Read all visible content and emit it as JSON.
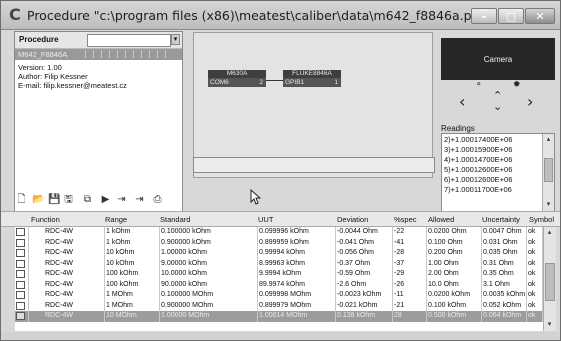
{
  "window": {
    "title": "Procedure \"c:\\program files (x86)\\meatest\\caliber\\data\\m642_f8846a.pro\"",
    "app_icon_glyph": "C",
    "minimize_glyph": "–",
    "maximize_glyph": "□",
    "close_glyph": "✕"
  },
  "procedure": {
    "label": "Procedure",
    "search_value": "",
    "combo_glyph": "▾",
    "item_name": "M642_F8846A",
    "info_lines": [
      "Version: 1.00",
      "Author: Filip Kessner",
      "E-mail: filip.kessner@meatest.cz"
    ]
  },
  "toolbar": {
    "new_glyph": "🗋",
    "open_glyph": "📂",
    "save_glyph": "💾",
    "save_as_glyph": "🖫",
    "link_glyph": "⧉",
    "run_glyph": "▶",
    "step_glyph": "⇥",
    "step2_glyph": "⇥",
    "report_glyph": "⎙"
  },
  "diagram": {
    "node1": {
      "title": "M630A",
      "port": "COM6",
      "number": "2"
    },
    "node2": {
      "title": "FLUKE8846A",
      "port": "GPIB1",
      "number": "1"
    }
  },
  "camera": {
    "label": "Camera",
    "ctrl_rec": "⚬",
    "ctrl_light": "✹",
    "left": "‹",
    "right": "›",
    "up": "⌃",
    "down": "⌄"
  },
  "readings": {
    "label": "Readings",
    "items": [
      "2)+1.00017400E+06",
      "3)+1.00015900E+06",
      "4)+1.00014700E+06",
      "5)+1.00012600E+06",
      "6)+1.00012600E+06",
      "7)+1.00011700E+06"
    ],
    "up_arrow": "▴",
    "down_arrow": "▾"
  },
  "grid": {
    "columns": [
      "Function",
      "Range",
      "Standard",
      "UUT",
      "Deviation",
      "%spec",
      "Allowed",
      "Uncertainty",
      "Symbol"
    ],
    "rows": [
      [
        "RDC-4W",
        "1 kOhm",
        "0.100000 kOhm",
        "0.099996 kOhm",
        "-0.0044 Ohm",
        "-22",
        "0.0200 Ohm",
        "0.0047 Ohm",
        "ok"
      ],
      [
        "RDC-4W",
        "1 kOhm",
        "0.900000 kOhm",
        "0.899959 kOhm",
        "-0.041 Ohm",
        "-41",
        "0.100 Ohm",
        "0.031 Ohm",
        "ok"
      ],
      [
        "RDC-4W",
        "10 kOhm",
        "1.00000 kOhm",
        "0.99994 kOhm",
        "-0.056 Ohm",
        "-28",
        "0.200 Ohm",
        "0.035 Ohm",
        "ok"
      ],
      [
        "RDC-4W",
        "10 kOhm",
        "9.00000 kOhm",
        "8.99963 kOhm",
        "-0.37 Ohm",
        "-37",
        "1.00 Ohm",
        "0.31 Ohm",
        "ok"
      ],
      [
        "RDC-4W",
        "100 kOhm",
        "10.0000 kOhm",
        "9.9994 kOhm",
        "-0.59 Ohm",
        "-29",
        "2.00 Ohm",
        "0.35 Ohm",
        "ok"
      ],
      [
        "RDC-4W",
        "100 kOhm",
        "90.0000 kOhm",
        "89.9974 kOhm",
        "-2.6 Ohm",
        "-26",
        "10.0 Ohm",
        "3.1 Ohm",
        "ok"
      ],
      [
        "RDC-4W",
        "1 MOhm",
        "0.100000 MOhm",
        "0.099998 MOhm",
        "-0.0023 kOhm",
        "-11",
        "0.0200 kOhm",
        "0.0035 kOhm",
        "ok"
      ],
      [
        "RDC-4W",
        "1 MOhm",
        "0.900000 MOhm",
        "0.899979 MOhm",
        "-0.021 kOhm",
        "-21",
        "0.100 kOhm",
        "0.052 kOhm",
        "ok"
      ],
      [
        "RDC-4W",
        "10 MOhm",
        "1.00000 MOhm",
        "1.00014 MOhm",
        "0.138 kOhm",
        "28",
        "0.500 kOhm",
        "0.064 kOhm",
        "ok"
      ]
    ],
    "selected_row": 8,
    "up_arrow": "▴",
    "down_arrow": "▾"
  }
}
